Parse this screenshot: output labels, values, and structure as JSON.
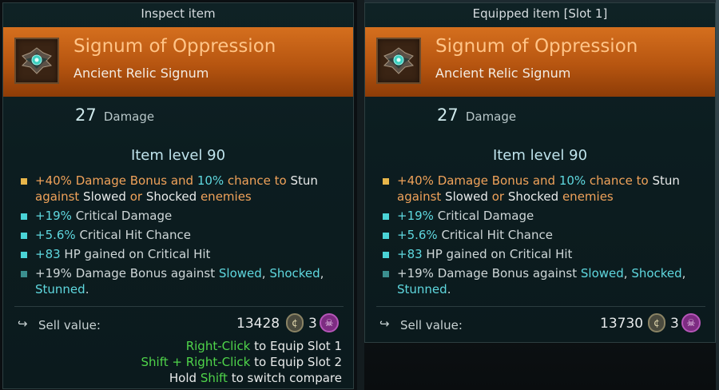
{
  "colors": {
    "header_orange": "#c05f16",
    "item_name": "#ffc487",
    "highlight_orange": "#f0a25a",
    "highlight_cyan": "#5fd8df",
    "bullet_gold": "#e8b64a",
    "bullet_cyan": "#4ad3d6",
    "bullet_dim": "#3b8f8f",
    "hint_green": "#4fd44a"
  },
  "left": {
    "title": "Inspect item",
    "name": "Signum of Oppression",
    "type": "Ancient Relic Signum",
    "damage_value": "27",
    "damage_label": "Damage",
    "item_level": "Item level 90",
    "stats": {
      "s1": {
        "a": "+40%",
        "b": " Damage Bonus and ",
        "c": "10%",
        "d": " chance to ",
        "e": "Stun",
        "f": "against",
        "g": " Slowed",
        "h": " or ",
        "i": "Shocked",
        "j": " enemies"
      },
      "s2": {
        "a": "+19%",
        "b": " Critical Damage"
      },
      "s3": {
        "a": "+5.6%",
        "b": " Critical Hit Chance"
      },
      "s4": {
        "a": "+83",
        "b": " HP gained on Critical Hit"
      },
      "s5": {
        "a": "+19%",
        "b": " Damage Bonus against ",
        "c": "Slowed",
        "d": ", ",
        "e": "Shocked",
        "f": ",",
        "g": "Stunned",
        "h": "."
      }
    },
    "sell_label": "Sell value:",
    "sell_value": "13428",
    "skull_count": "3",
    "hints": {
      "h1a": "Right-Click",
      "h1b": " to Equip Slot 1",
      "h2a": "Shift + Right-Click",
      "h2b": " to Equip Slot 2",
      "h3a": "Hold ",
      "h3b": "Shift",
      "h3c": " to switch compare"
    }
  },
  "right": {
    "title": "Equipped item [Slot 1]",
    "name": "Signum of Oppression",
    "type": "Ancient Relic Signum",
    "damage_value": "27",
    "damage_label": "Damage",
    "item_level": "Item level 90",
    "stats": {
      "s1": {
        "a": "+40%",
        "b": " Damage Bonus and ",
        "c": "10%",
        "d": " chance to ",
        "e": "Stun",
        "f": "against",
        "g": " Slowed",
        "h": " or ",
        "i": "Shocked",
        "j": " enemies"
      },
      "s2": {
        "a": "+19%",
        "b": " Critical Damage"
      },
      "s3": {
        "a": "+5.6%",
        "b": " Critical Hit Chance"
      },
      "s4": {
        "a": "+83",
        "b": " HP gained on Critical Hit"
      },
      "s5": {
        "a": "+19%",
        "b": " Damage Bonus against ",
        "c": "Slowed",
        "d": ", ",
        "e": "Shocked",
        "f": ",",
        "g": "Stunned",
        "h": "."
      }
    },
    "sell_label": "Sell value:",
    "sell_value": "13730",
    "skull_count": "3"
  },
  "icons": {
    "relic": "signum-relic-icon",
    "sell": "sell-arrow-icon",
    "gold": "glyph-coin-icon",
    "skull": "skull-currency-icon"
  }
}
